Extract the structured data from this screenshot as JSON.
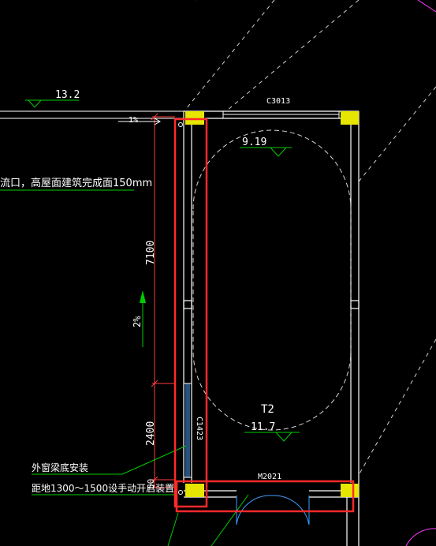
{
  "drawing": {
    "elevations": {
      "left_top": "13.2",
      "room_top": "9.19",
      "room_bottom": "11.7"
    },
    "slope_top": "1%",
    "slope_mid": "2%",
    "window_top_tag": "C3013",
    "door_bottom_tag": "M2021",
    "vertical_window_tag": "C1423",
    "room_name": "T2",
    "dimensions": {
      "upper": "7100",
      "lower": "2400",
      "tail": "50"
    },
    "note_drain": "流口，高屋面建筑完成面150mm",
    "note_window_1": "外窗梁底安装",
    "note_window_2": "距地1300～1500设手动开启装置",
    "colors": {
      "background": "#000000",
      "wall": "#ffffff",
      "column": "#e6e600",
      "highlight": "#ff2a2a",
      "leader": "#00cc00",
      "dimension": "#ff3b3b",
      "glass": "#4aa3ff",
      "door_swing": "#3aa0ff"
    }
  }
}
